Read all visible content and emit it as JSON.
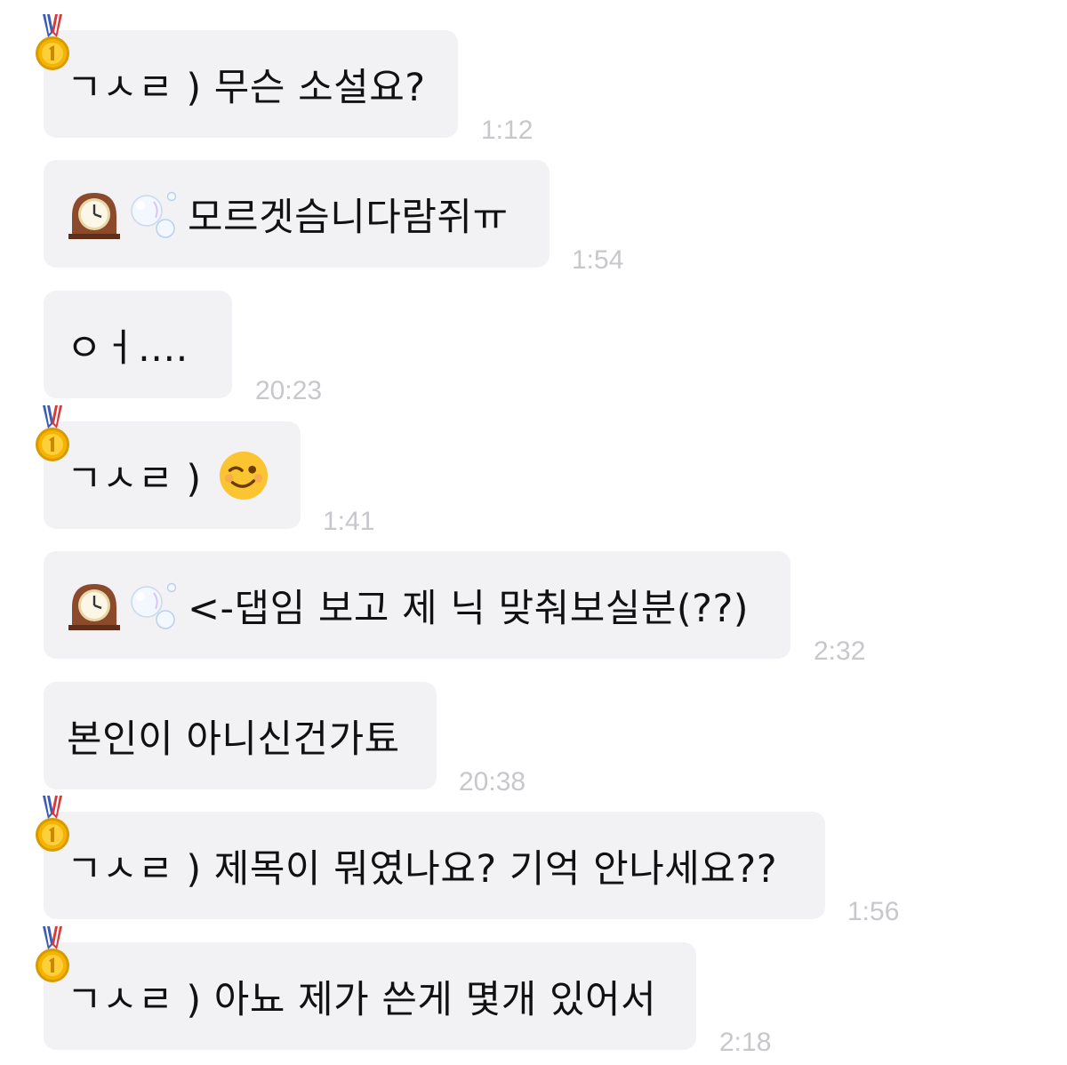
{
  "messages": [
    {
      "text": "ㄱㅅㄹ ) 무슨 소설요?",
      "time": "1:12",
      "badge": "medal-icon",
      "emoji_prefix": []
    },
    {
      "text": "모르겟슴니다람쥐ㅠ",
      "time": "1:54",
      "badge": null,
      "emoji_prefix": [
        "mantelpiece-clock-icon",
        "bubbles-icon"
      ]
    },
    {
      "text": "ㅇㅓ....",
      "time": "20:23",
      "badge": null,
      "emoji_prefix": []
    },
    {
      "text": "ㄱㅅㄹ )",
      "time": "1:41",
      "badge": "medal-icon",
      "emoji_prefix": [],
      "emoji_suffix": "winking-face-icon"
    },
    {
      "text": "<-댑임 보고 제 닉 맞춰보실분(??)",
      "time": "2:32",
      "badge": null,
      "emoji_prefix": [
        "mantelpiece-clock-icon",
        "bubbles-icon"
      ]
    },
    {
      "text": "본인이 아니신건가툐",
      "time": "20:38",
      "badge": null,
      "emoji_prefix": []
    },
    {
      "text": "ㄱㅅㄹ ) 제목이 뭐였나요? 기억 안나세요??",
      "time": "1:56",
      "badge": "medal-icon",
      "emoji_prefix": []
    },
    {
      "text": "ㄱㅅㄹ ) 아뇨 제가 쓴게 몇개 있어서",
      "time": "2:18",
      "badge": "medal-icon",
      "emoji_prefix": []
    }
  ],
  "colors": {
    "bubble": "#f2f2f5",
    "text": "#111111",
    "time": "#c7c7cc",
    "medal_gold": "#f4b400",
    "ribbon_blue": "#3b5bb5",
    "ribbon_red": "#d83a3a"
  }
}
